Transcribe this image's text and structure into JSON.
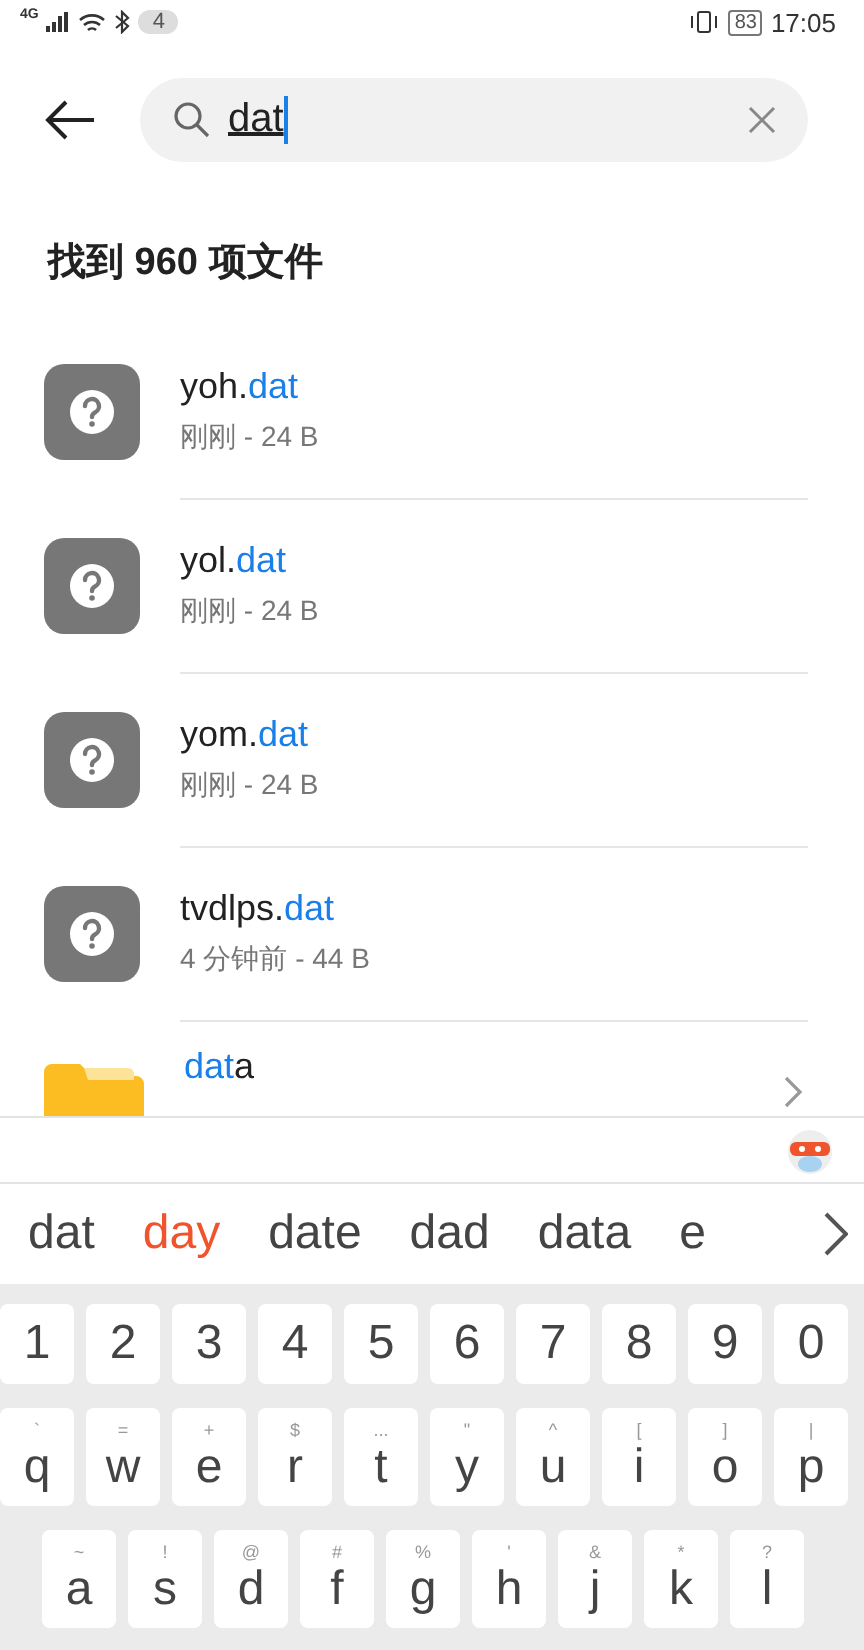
{
  "status_bar": {
    "network": "4G",
    "notifications": "4",
    "battery": "83",
    "time": "17:05"
  },
  "search": {
    "value": "dat"
  },
  "heading": "找到 960 项文件",
  "results": [
    {
      "kind": "file",
      "name_parts": [
        {
          "text": "yoh.",
          "match": false
        },
        {
          "text": "dat",
          "match": true
        }
      ],
      "meta": "刚刚 - 24 B"
    },
    {
      "kind": "file",
      "name_parts": [
        {
          "text": "yol.",
          "match": false
        },
        {
          "text": "dat",
          "match": true
        }
      ],
      "meta": "刚刚 - 24 B"
    },
    {
      "kind": "file",
      "name_parts": [
        {
          "text": "yom.",
          "match": false
        },
        {
          "text": "dat",
          "match": true
        }
      ],
      "meta": "刚刚 - 24 B"
    },
    {
      "kind": "file",
      "name_parts": [
        {
          "text": "tvdlps.",
          "match": false
        },
        {
          "text": "dat",
          "match": true
        }
      ],
      "meta": "4 分钟前 - 44 B"
    },
    {
      "kind": "folder",
      "name_parts": [
        {
          "text": "dat",
          "match": true
        },
        {
          "text": "a",
          "match": false
        }
      ]
    }
  ],
  "suggestions": [
    {
      "text": "dat",
      "selected": false
    },
    {
      "text": "day",
      "selected": true
    },
    {
      "text": "date",
      "selected": false
    },
    {
      "text": "dad",
      "selected": false
    },
    {
      "text": "data",
      "selected": false
    },
    {
      "text": "e",
      "selected": false
    }
  ],
  "keyboard": [
    [
      {
        "key": "1"
      },
      {
        "key": "2"
      },
      {
        "key": "3"
      },
      {
        "key": "4"
      },
      {
        "key": "5"
      },
      {
        "key": "6"
      },
      {
        "key": "7"
      },
      {
        "key": "8"
      },
      {
        "key": "9"
      },
      {
        "key": "0"
      }
    ],
    [
      {
        "key": "q",
        "alt": "`"
      },
      {
        "key": "w",
        "alt": "="
      },
      {
        "key": "e",
        "alt": "+"
      },
      {
        "key": "r",
        "alt": "$"
      },
      {
        "key": "t",
        "alt": "..."
      },
      {
        "key": "y",
        "alt": "\""
      },
      {
        "key": "u",
        "alt": "^"
      },
      {
        "key": "i",
        "alt": "["
      },
      {
        "key": "o",
        "alt": "]"
      },
      {
        "key": "p",
        "alt": "|"
      }
    ],
    [
      {
        "key": "a",
        "alt": "~"
      },
      {
        "key": "s",
        "alt": "!"
      },
      {
        "key": "d",
        "alt": "@"
      },
      {
        "key": "f",
        "alt": "#"
      },
      {
        "key": "g",
        "alt": "%"
      },
      {
        "key": "h",
        "alt": "'"
      },
      {
        "key": "j",
        "alt": "&"
      },
      {
        "key": "k",
        "alt": "*"
      },
      {
        "key": "l",
        "alt": "?"
      }
    ]
  ]
}
